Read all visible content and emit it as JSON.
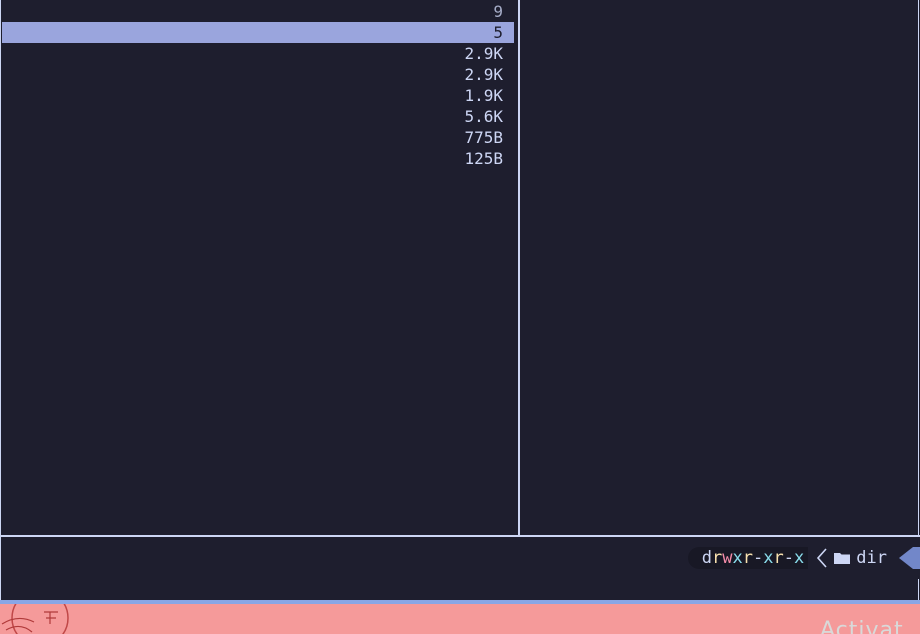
{
  "file_list": {
    "rows": [
      {
        "size": "9",
        "state": "dim"
      },
      {
        "size": "5",
        "state": "selected"
      },
      {
        "size": "2.9K",
        "state": "normal"
      },
      {
        "size": "2.9K",
        "state": "normal"
      },
      {
        "size": "1.9K",
        "state": "normal"
      },
      {
        "size": "5.6K",
        "state": "normal"
      },
      {
        "size": "775B",
        "state": "normal"
      },
      {
        "size": "125B",
        "state": "normal"
      }
    ]
  },
  "status": {
    "permissions": [
      {
        "char": "d",
        "color": "#cdd6f4"
      },
      {
        "char": "r",
        "color": "#f9e2af"
      },
      {
        "char": "w",
        "color": "#f38ba8"
      },
      {
        "char": "x",
        "color": "#89dceb"
      },
      {
        "char": "r",
        "color": "#f9e2af"
      },
      {
        "char": "-",
        "color": "#cdd6f4"
      },
      {
        "char": "x",
        "color": "#89dceb"
      },
      {
        "char": "r",
        "color": "#f9e2af"
      },
      {
        "char": "-",
        "color": "#cdd6f4"
      },
      {
        "char": "x",
        "color": "#89dceb"
      }
    ],
    "separator_icon": "chevron-left-icon",
    "type_icon": "folder-icon",
    "type_label": "dir",
    "mode_color": "#7287c9"
  },
  "desktop_watermark": {
    "text": "Activat"
  },
  "colors": {
    "background": "#1e1e2e",
    "foreground": "#cdd6f4",
    "selection": "#9aa5dd",
    "taskbar": "#f59a9a",
    "accent_rule": "#89a6e6"
  }
}
